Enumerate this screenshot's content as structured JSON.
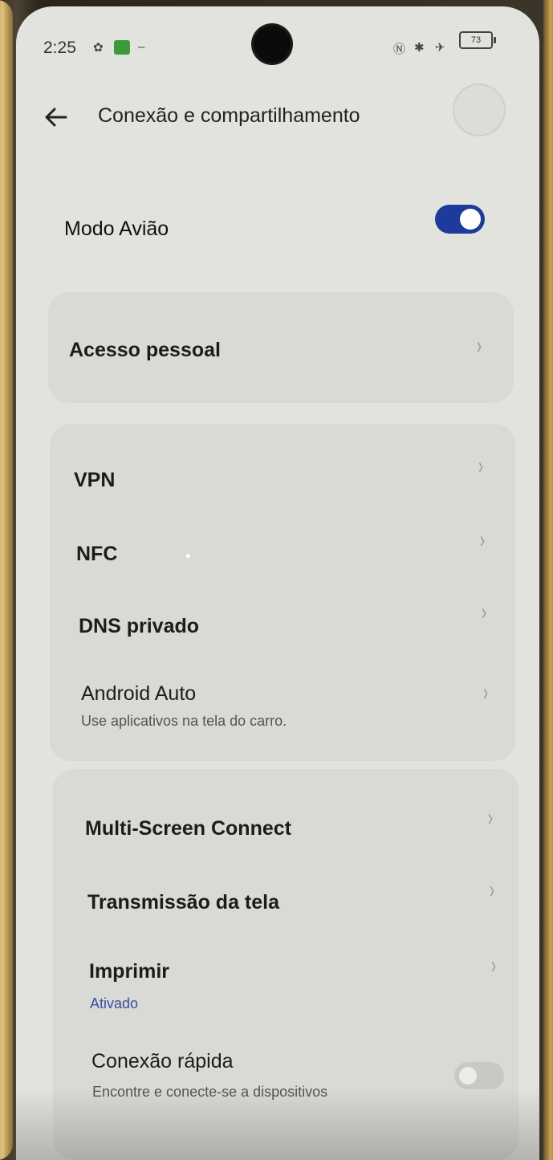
{
  "status_bar": {
    "time": "2:25",
    "battery": "73"
  },
  "header": {
    "title": "Conexão e compartilhamento"
  },
  "airplane": {
    "label": "Modo Avião",
    "on": true
  },
  "personal_access": {
    "label": "Acesso pessoal"
  },
  "group2": [
    {
      "label": "VPN"
    },
    {
      "label": "NFC"
    },
    {
      "label": "DNS privado"
    },
    {
      "label": "Android Auto",
      "sub": "Use aplicativos na tela do carro."
    }
  ],
  "group3": [
    {
      "label": "Multi-Screen Connect"
    },
    {
      "label": "Transmissão da tela"
    },
    {
      "label": "Imprimir",
      "sub": "Ativado"
    },
    {
      "label": "Conexão rápida",
      "sub": "Encontre e conecte-se a dispositivos"
    }
  ],
  "colors": {
    "accent": "#1d3a9c",
    "link_sub": "#3a4fa3",
    "bg": "#e2e2de"
  }
}
